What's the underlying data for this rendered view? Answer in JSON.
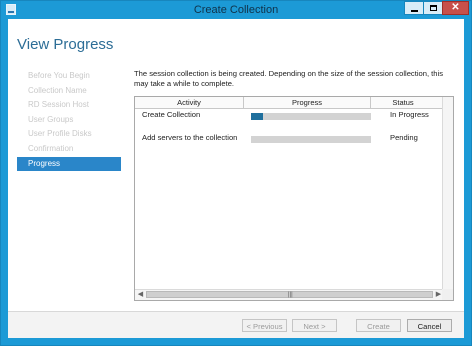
{
  "window": {
    "title": "Create Collection"
  },
  "page": {
    "title": "View Progress"
  },
  "nav": {
    "items": [
      {
        "label": "Before You Begin"
      },
      {
        "label": "Collection Name"
      },
      {
        "label": "RD Session Host"
      },
      {
        "label": "User Groups"
      },
      {
        "label": "User Profile Disks"
      },
      {
        "label": "Confirmation"
      },
      {
        "label": "Progress",
        "active": true
      }
    ]
  },
  "content": {
    "intro": "The session collection is being created. Depending on the size of the session collection, this may take a while to complete.",
    "columns": [
      "Activity",
      "Progress",
      "Status"
    ],
    "rows": [
      {
        "activity": "Create Collection",
        "progress": 0.1,
        "status": "In Progress"
      },
      {
        "activity": "Add servers to the collection",
        "progress": 0.0,
        "status": "Pending"
      }
    ]
  },
  "buttons": {
    "previous": "< Previous",
    "next": "Next >",
    "create": "Create",
    "cancel": "Cancel"
  },
  "colors": {
    "titlebar": "#1c9ad6",
    "nav_active": "#2a86c9",
    "progress_fill": "#1f6f9d",
    "close_button": "#c7504b"
  }
}
